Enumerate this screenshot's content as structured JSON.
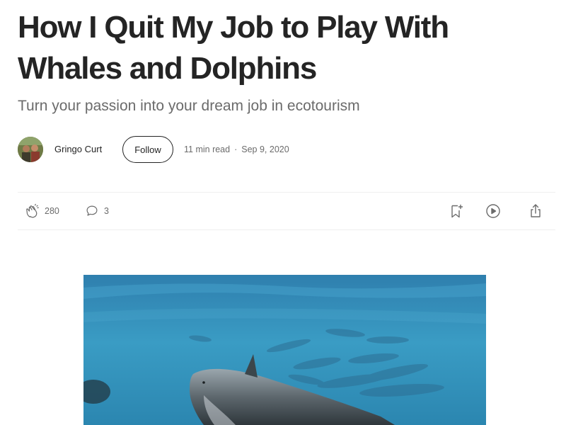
{
  "article": {
    "title": "How I Quit My Job to Play With Whales and Dolphins",
    "subtitle": "Turn your passion into your dream job in ecotourism"
  },
  "byline": {
    "author": "Gringo Curt",
    "follow_label": "Follow",
    "read_time": "11 min read",
    "separator": "·",
    "date": "Sep 9, 2020"
  },
  "actions": {
    "claps": "280",
    "comments": "3",
    "icons": [
      "clap-icon",
      "comment-icon",
      "bookmark-icon",
      "play-icon",
      "share-icon"
    ]
  },
  "colors": {
    "text": "#242424",
    "muted": "#6b6b6b",
    "divider": "#efefef",
    "ocean": "#3a9cc4"
  }
}
